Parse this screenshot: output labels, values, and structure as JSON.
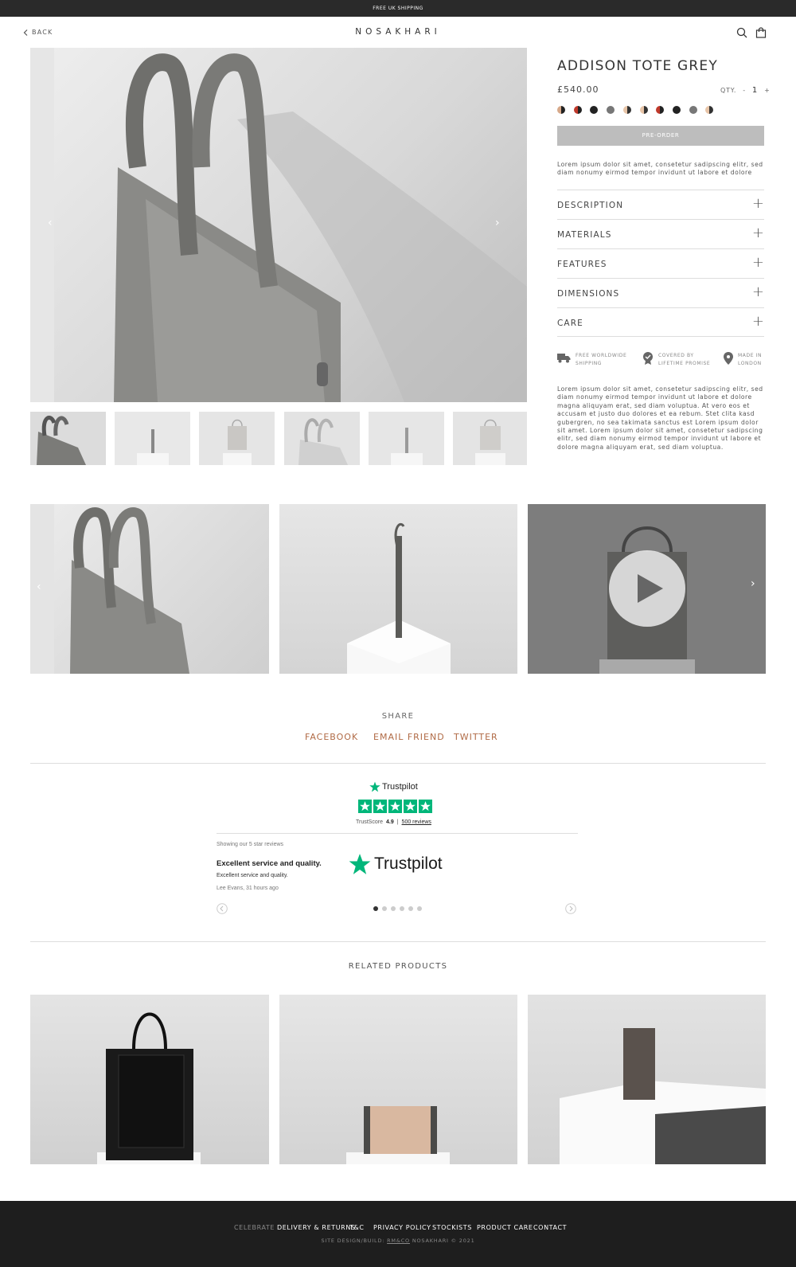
{
  "topbar": {
    "text": "FREE UK SHIPPING"
  },
  "header": {
    "back": "BACK",
    "logo": "NOSAKHARI"
  },
  "product": {
    "title": "ADDISON TOTE GREY",
    "price": "£540.00",
    "qty_label": "QTY.",
    "qty_minus": "-",
    "qty_value": "1",
    "qty_plus": "+",
    "swatches": [
      "#d7a98a|#222",
      "#c0392b|#222",
      "#222",
      "#777",
      "#e8c5a8|#333",
      "#e8c5a8|#333",
      "#c0392b|#222",
      "#222",
      "#777",
      "#e8c5a8|#333"
    ],
    "button": "PRE-ORDER",
    "intro": "Lorem ipsum dolor sit amet, consetetur sadipscing elitr, sed diam nonumy eirmod tempor invidunt ut labore et dolore",
    "accordion": [
      "DESCRIPTION",
      "MATERIALS",
      "FEATURES",
      "DIMENSIONS",
      "CARE"
    ],
    "perks": [
      {
        "icon": "truck-icon",
        "line1": "FREE WORLDWIDE",
        "line2": "SHIPPING"
      },
      {
        "icon": "badge-check-icon",
        "line1": "COVERED BY",
        "line2": "LIFETIME PROMISE"
      },
      {
        "icon": "location-pin-icon",
        "line1": "MADE IN",
        "line2": "LONDON"
      }
    ],
    "body": "Lorem ipsum dolor sit amet, consetetur sadipscing elitr, sed diam nonumy eirmod tempor invidunt ut labore et dolore magna aliquyam erat, sed diam voluptua. At vero eos et accusam et justo duo dolores et ea rebum. Stet clita kasd gubergren, no sea takimata sanctus est Lorem ipsum dolor sit amet. Lorem ipsum dolor sit amet, consetetur sadipscing elitr, sed diam nonumy eirmod tempor invidunt ut labore et dolore magna aliquyam erat, sed diam voluptua."
  },
  "share": {
    "title": "SHARE",
    "links": [
      "FACEBOOK",
      "EMAIL FRIEND",
      "TWITTER"
    ]
  },
  "trustpilot": {
    "brand": "Trustpilot",
    "score_label": "TrustScore",
    "score": "4.9",
    "reviews": "500 reviews",
    "showing": "Showing our 5 star reviews",
    "review_title": "Excellent service and quality.",
    "review_text": "Excellent service and quality.",
    "review_author": "Lee Evans, 31 hours ago",
    "active_dot": 0,
    "dot_count": 6
  },
  "related": {
    "title": "RELATED PRODUCTS"
  },
  "footer": {
    "links": [
      "CELEBRATE",
      "DELIVERY & RETURNS",
      "T&C",
      "PRIVACY POLICY",
      "STOCKISTS",
      "PRODUCT CARE",
      "CONTACT"
    ],
    "credit_prefix": "SITE DESIGN/BUILD:",
    "credit_link": "RM&CO",
    "credit_suffix": "NOSAKHARI © 2021"
  },
  "colors": {
    "accent": "#b06a45",
    "trustpilot_green": "#00b67a",
    "footer_bg": "#1e1e1e",
    "button_bg": "#bdbdbd"
  }
}
